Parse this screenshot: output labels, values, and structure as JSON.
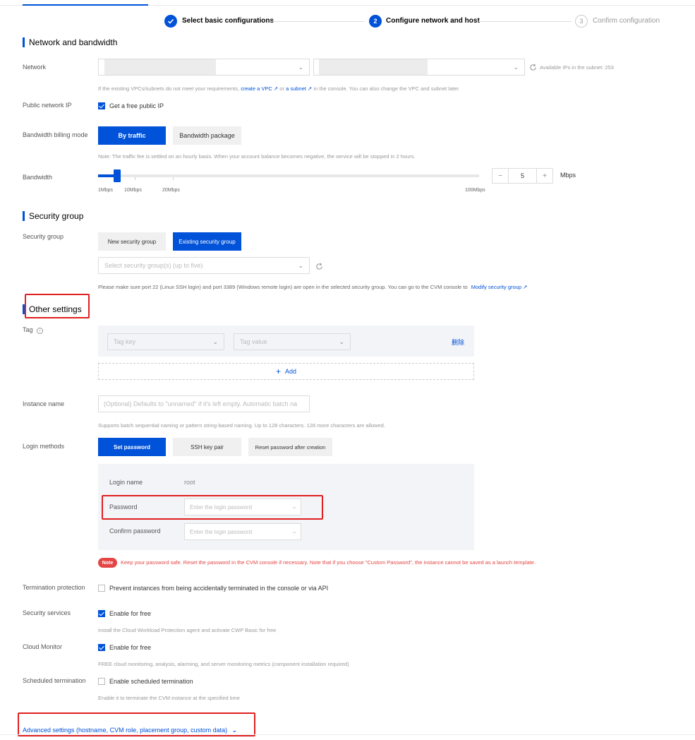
{
  "steps": [
    {
      "label": "Select basic configurations",
      "state": "done"
    },
    {
      "number": "2",
      "label": "Configure network and host",
      "state": "active"
    },
    {
      "number": "3",
      "label": "Confirm configuration",
      "state": "todo"
    }
  ],
  "network_section": {
    "title": "Network and bandwidth",
    "network_label": "Network",
    "available_ips": "Available IPs in the subnet: 253",
    "hint_prefix": "If the existing VPCs/subnets do not meet your requirements,",
    "create_vpc": "create a VPC",
    "or": "or",
    "a_subnet": "a subnet",
    "hint_suffix": "in the console. You can also change the VPC and subnet later.",
    "public_ip_label": "Public network IP",
    "public_ip_checkbox": "Get a free public IP",
    "billing_label": "Bandwidth billing mode",
    "by_traffic": "By traffic",
    "bandwidth_package": "Bandwidth package",
    "billing_note": "Note: The traffic fee is settled on an hourly basis. When your account balance becomes negative, the service will be stopped in 2 hours.",
    "bandwidth_label": "Bandwidth",
    "bandwidth_value": "5",
    "bandwidth_unit": "Mbps",
    "ticks": [
      "1Mbps",
      "10Mbps",
      "20Mbps",
      "100Mbps"
    ],
    "minus": "−",
    "plus": "+"
  },
  "security_section": {
    "title": "Security group",
    "label": "Security group",
    "new_sg": "New security group",
    "existing_sg": "Existing security group",
    "select_placeholder": "Select security group(s) (up to five)",
    "hint": "Please make sure port 22 (Linux SSH login) and port 3389 (Windows remote login) are open in the selected security group. You can go to the CVM console to",
    "modify_link": "Modify security group"
  },
  "other_section": {
    "title": "Other settings",
    "tag_label": "Tag",
    "tag_key": "Tag key",
    "tag_value": "Tag value",
    "delete": "删除",
    "add": "Add",
    "instance_name_label": "Instance name",
    "instance_name_placeholder": "(Optional) Defaults to \"unnamed\" if it's left empty. Automatic batch na",
    "instance_name_hint": "Supports batch sequential naming or pattern string-based naming. Up to 128 characters. 128 more characters are allowed.",
    "login_label": "Login methods",
    "set_password": "Set password",
    "ssh_key": "SSH key pair",
    "reset_after": "Reset password after creation",
    "login_name_label": "Login name",
    "login_name_value": "root",
    "password_label": "Password",
    "password_placeholder": "Enter the login password",
    "confirm_label": "Confirm password",
    "confirm_placeholder": "Enter the login password",
    "note_badge": "Note",
    "note_text": "Keep your password safe. Reset the password in the CVM console if necessary. Note that if you choose \"Custom Password\", the instance cannot be saved as a launch template.",
    "termination_label": "Termination protection",
    "termination_checkbox": "Prevent instances from being accidentally terminated in the console or via API",
    "security_services_label": "Security services",
    "security_services_checkbox": "Enable for free",
    "security_services_hint": "Install the Cloud Workload Protection agent and activate CWP Basic for free",
    "cloud_monitor_label": "Cloud Monitor",
    "cloud_monitor_checkbox": "Enable for free",
    "cloud_monitor_hint": "FREE cloud monitoring, analysis, alarming, and server monitoring metrics (component installation required)",
    "scheduled_label": "Scheduled termination",
    "scheduled_checkbox": "Enable scheduled termination",
    "scheduled_hint": "Enable it to terminate the CVM instance at the specified time"
  },
  "advanced": {
    "label": "Advanced settings (hostname, CVM role, placement group, custom data)"
  },
  "colors": {
    "primary": "#0052d9",
    "highlight_box": "#e02020",
    "note": "#e54545"
  },
  "bandwidth_fraction": 0.05
}
